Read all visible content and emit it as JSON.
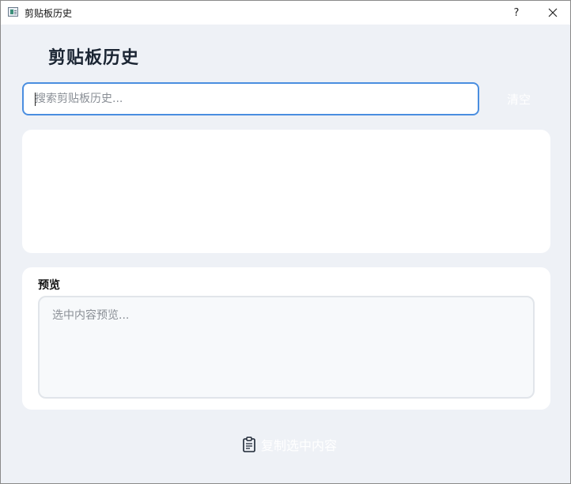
{
  "window": {
    "title": "剪贴板历史",
    "help_label": "?"
  },
  "header": {
    "title": "剪贴板历史"
  },
  "search": {
    "value": "",
    "placeholder": "搜索剪贴板历史..."
  },
  "toolbar": {
    "clear_label": "清空"
  },
  "history": {
    "items": []
  },
  "preview": {
    "label": "预览",
    "value": "",
    "placeholder": "选中内容预览..."
  },
  "actions": {
    "copy_label": "复制选中内容",
    "copy_icon": "clipboard-icon"
  },
  "colors": {
    "accent": "#4a8ee0",
    "background": "#eef1f6",
    "card": "#ffffff"
  }
}
